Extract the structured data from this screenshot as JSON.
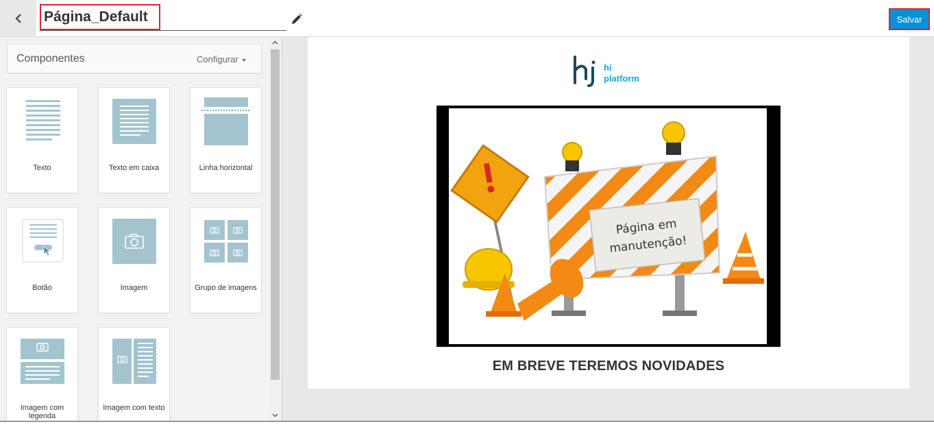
{
  "header": {
    "page_title": "Página_Default",
    "save_label": "Salvar"
  },
  "sidebar": {
    "panel_title": "Componentes",
    "configure_label": "Configurar",
    "components": [
      {
        "label": "Texto",
        "icon": "text-block-icon"
      },
      {
        "label": "Texto em caixa",
        "icon": "boxed-text-icon"
      },
      {
        "label": "Linha horizontal",
        "icon": "horizontal-line-icon"
      },
      {
        "label": "Botão",
        "icon": "button-icon"
      },
      {
        "label": "Imagem",
        "icon": "image-icon"
      },
      {
        "label": "Grupo de imagens",
        "icon": "image-group-icon"
      },
      {
        "label": "Imagem com legenda",
        "icon": "image-caption-icon"
      },
      {
        "label": "Imagem com texto",
        "icon": "image-text-icon"
      }
    ]
  },
  "canvas": {
    "logo_text_line1": "hi",
    "logo_text_line2": "platform",
    "sign_line1": "Página em",
    "sign_line2": "manutenção!",
    "heading": "EM BREVE TEREMOS NOVIDADES"
  },
  "colors": {
    "accent": "#0a8fdb",
    "highlight": "#d9262c",
    "icon_fill": "#a3c4cf",
    "logo_dark": "#1b4a5a",
    "logo_light": "#18a7d8"
  }
}
